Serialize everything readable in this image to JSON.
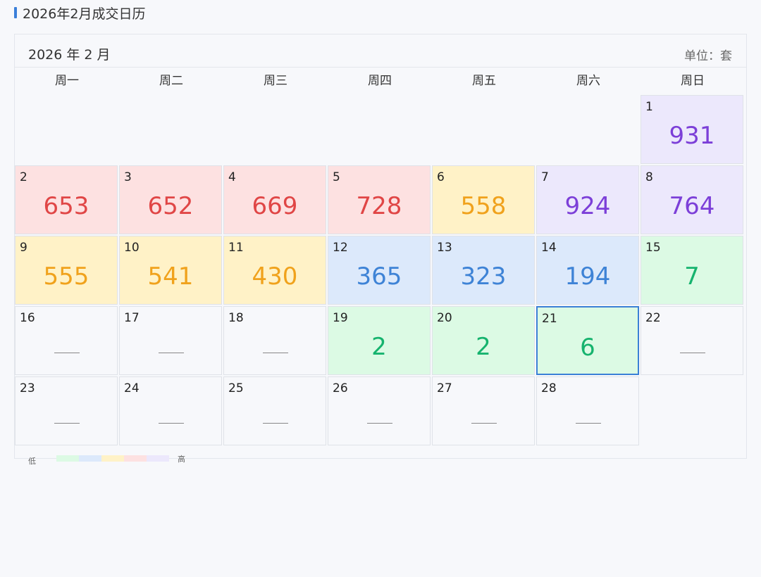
{
  "section": {
    "title": "2026年2月成交日历"
  },
  "calendar": {
    "month_label": "2026 年 2 月",
    "unit_label": "单位：套",
    "weekdays": [
      "周一",
      "周二",
      "周三",
      "周四",
      "周五",
      "周六",
      "周日"
    ],
    "selected_day": "21",
    "empty_placeholder": "—",
    "weeks": [
      [
        null,
        null,
        null,
        null,
        null,
        null,
        {
          "day": "1",
          "value": "931",
          "level": "purple"
        }
      ],
      [
        {
          "day": "2",
          "value": "653",
          "level": "red"
        },
        {
          "day": "3",
          "value": "652",
          "level": "red"
        },
        {
          "day": "4",
          "value": "669",
          "level": "red"
        },
        {
          "day": "5",
          "value": "728",
          "level": "red"
        },
        {
          "day": "6",
          "value": "558",
          "level": "yellow"
        },
        {
          "day": "7",
          "value": "924",
          "level": "purple"
        },
        {
          "day": "8",
          "value": "764",
          "level": "purple"
        }
      ],
      [
        {
          "day": "9",
          "value": "555",
          "level": "yellow"
        },
        {
          "day": "10",
          "value": "541",
          "level": "yellow"
        },
        {
          "day": "11",
          "value": "430",
          "level": "yellow"
        },
        {
          "day": "12",
          "value": "365",
          "level": "blue"
        },
        {
          "day": "13",
          "value": "323",
          "level": "blue"
        },
        {
          "day": "14",
          "value": "194",
          "level": "blue"
        },
        {
          "day": "15",
          "value": "7",
          "level": "green"
        }
      ],
      [
        {
          "day": "16",
          "value": null,
          "level": "none"
        },
        {
          "day": "17",
          "value": null,
          "level": "none"
        },
        {
          "day": "18",
          "value": null,
          "level": "none"
        },
        {
          "day": "19",
          "value": "2",
          "level": "green"
        },
        {
          "day": "20",
          "value": "2",
          "level": "green"
        },
        {
          "day": "21",
          "value": "6",
          "level": "green"
        },
        {
          "day": "22",
          "value": null,
          "level": "none"
        }
      ],
      [
        {
          "day": "23",
          "value": null,
          "level": "none"
        },
        {
          "day": "24",
          "value": null,
          "level": "none"
        },
        {
          "day": "25",
          "value": null,
          "level": "none"
        },
        {
          "day": "26",
          "value": null,
          "level": "none"
        },
        {
          "day": "27",
          "value": null,
          "level": "none"
        },
        {
          "day": "28",
          "value": null,
          "level": "none"
        },
        null
      ]
    ]
  },
  "legend": {
    "low_label": "低",
    "high_label": "高",
    "levels": [
      "green",
      "blue",
      "yellow",
      "red",
      "purple"
    ]
  },
  "colors": {
    "accent": "#3b7fd9",
    "green_bg": "#dcfae4",
    "green_fg": "#16b36e",
    "blue_bg": "#dce9fb",
    "blue_fg": "#3e83d6",
    "yellow_bg": "#fff2c7",
    "yellow_fg": "#f0a21c",
    "red_bg": "#fde1e1",
    "red_fg": "#e04646",
    "purple_bg": "#ece8fc",
    "purple_fg": "#7c3fd8"
  }
}
